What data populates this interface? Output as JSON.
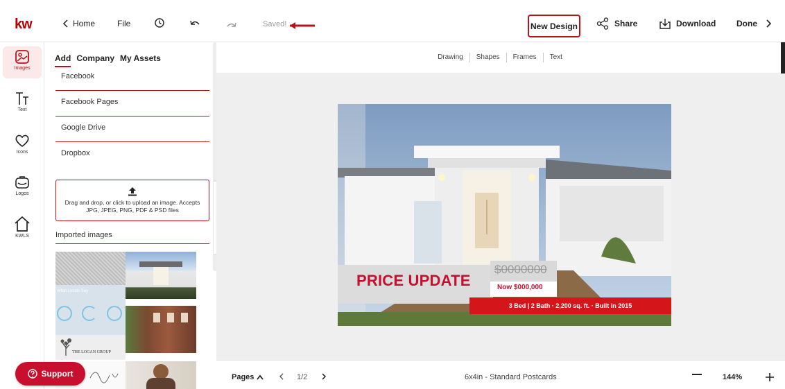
{
  "brand": {
    "logo_text": "kw",
    "accent": "#b5121b"
  },
  "topbar": {
    "home_label": "Home",
    "file_label": "File",
    "saved_label": "Saved!",
    "new_design_label": "New Design",
    "share_label": "Share",
    "download_label": "Download",
    "done_label": "Done"
  },
  "rail": {
    "items": [
      {
        "label": "Images",
        "icon": "images-icon"
      },
      {
        "label": "Text",
        "icon": "text-icon"
      },
      {
        "label": "Icons",
        "icon": "heart-icon"
      },
      {
        "label": "Logos",
        "icon": "briefcase-icon"
      },
      {
        "label": "KWLS",
        "icon": "house-icon"
      }
    ]
  },
  "panel": {
    "tabs": [
      "Add",
      "Company",
      "My Assets"
    ],
    "sources": [
      "Facebook",
      "Facebook Pages",
      "Google Drive",
      "Dropbox"
    ],
    "upload_text": "Drag and drop, or click to upload an image. Accepts JPG, JPEG, PNG, PDF & PSD files",
    "imported_label": "Imported images",
    "thumb_texts": [
      "What Locals Say",
      "THE LOGAN GROUP"
    ]
  },
  "support": {
    "label": "Support"
  },
  "canvas": {
    "tools": [
      "Drawing",
      "Shapes",
      "Frames",
      "Text"
    ]
  },
  "postcard": {
    "headline": "PRICE UPDATE",
    "old_price": "$0000000",
    "new_price": "Now $000,000",
    "details": "3 Bed | 2 Bath · 2,200 sq. ft. · Built in 2015"
  },
  "bottombar": {
    "pages_label": "Pages",
    "page_indicator": "1/2",
    "format_label": "6x4in - Standard Postcards",
    "zoom": "144%"
  }
}
